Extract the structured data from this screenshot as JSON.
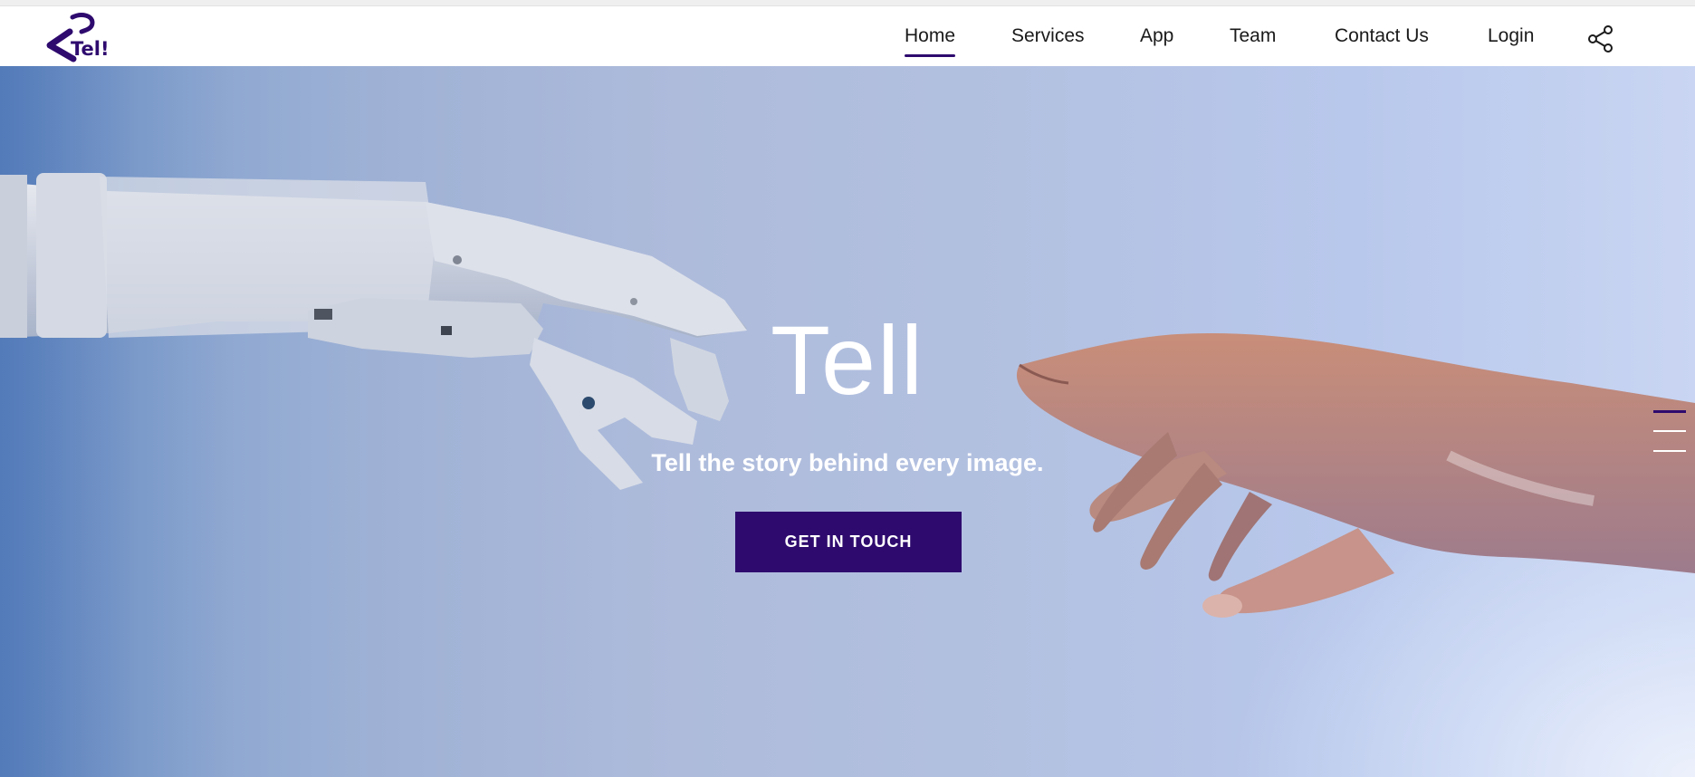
{
  "brand": {
    "logo_text": "Tel!",
    "accent_color": "#2e0a6e"
  },
  "nav": {
    "items": [
      {
        "label": "Home",
        "active": true
      },
      {
        "label": "Services",
        "active": false
      },
      {
        "label": "App",
        "active": false
      },
      {
        "label": "Team",
        "active": false
      },
      {
        "label": "Contact Us",
        "active": false
      },
      {
        "label": "Login",
        "active": false
      }
    ],
    "share_icon": "share-icon"
  },
  "hero": {
    "title": "Tell",
    "subtitle": "Tell the story behind every image.",
    "cta_label": "GET IN TOUCH",
    "image_subject": "robot hand reaching toward a human hand",
    "slides": {
      "count": 3,
      "active_index": 0
    }
  }
}
